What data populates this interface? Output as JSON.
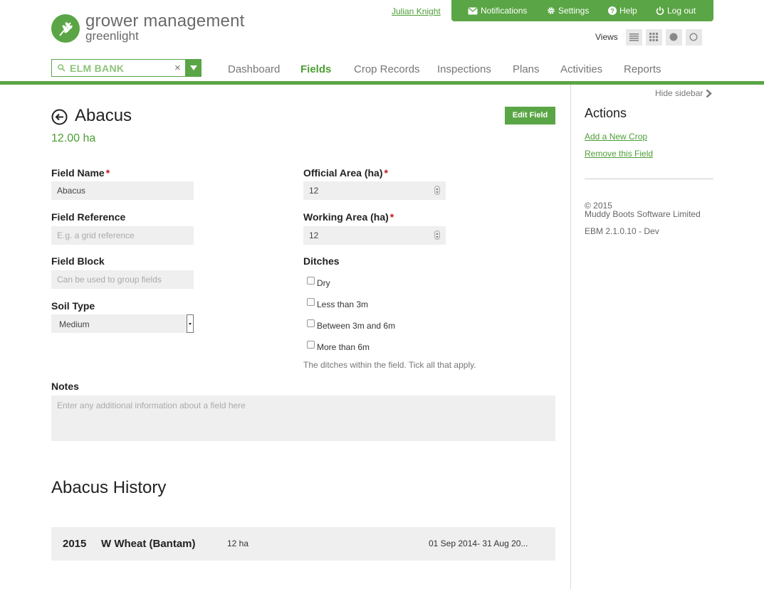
{
  "brand": {
    "title": "grower management",
    "subtitle": "greenlight"
  },
  "topbar": {
    "user": "Julian Knight",
    "notifications": "Notifications",
    "settings": "Settings",
    "help": "Help",
    "logout": "Log out"
  },
  "views": {
    "label": "Views"
  },
  "search": {
    "value": "ELM BANK"
  },
  "nav": [
    "Dashboard",
    "Fields",
    "Crop Records",
    "Inspections",
    "Plans",
    "Activities",
    "Reports"
  ],
  "nav_active": "Fields",
  "page": {
    "title": "Abacus",
    "area": "12.00 ha",
    "edit_button": "Edit Field"
  },
  "form": {
    "field_name": {
      "label": "Field Name",
      "required": "*",
      "value": "Abacus"
    },
    "field_reference": {
      "label": "Field Reference",
      "placeholder": "E.g. a grid reference"
    },
    "field_block": {
      "label": "Field Block",
      "placeholder": "Can be used to group fields"
    },
    "soil_type": {
      "label": "Soil Type",
      "value": "Medium"
    },
    "official_area": {
      "label": "Official Area (ha)",
      "required": "*",
      "value": "12"
    },
    "working_area": {
      "label": "Working Area (ha)",
      "required": "*",
      "value": "12"
    },
    "ditches": {
      "label": "Ditches",
      "options": [
        "Dry",
        "Less than 3m",
        "Between 3m and 6m",
        "More than 6m"
      ],
      "hint": "The ditches within the field. Tick all that apply."
    },
    "notes": {
      "label": "Notes",
      "placeholder": "Enter any additional information about a field here"
    }
  },
  "history": {
    "title": "Abacus History",
    "rows": [
      {
        "year": "2015",
        "crop": "W Wheat (Bantam)",
        "area": "12 ha",
        "dates": "01 Sep 2014- 31 Aug 20..."
      }
    ]
  },
  "sidebar": {
    "hide_label": "Hide sidebar",
    "actions_title": "Actions",
    "links": [
      "Add a New Crop",
      "Remove this Field"
    ],
    "copyright": "© 2015",
    "company": "Muddy Boots Software Limited",
    "version": "EBM 2.1.0.10 - Dev"
  },
  "colors": {
    "accent": "#5aa545",
    "link": "#4c9e35",
    "required": "#c0161d",
    "field_bg": "#efefef"
  }
}
